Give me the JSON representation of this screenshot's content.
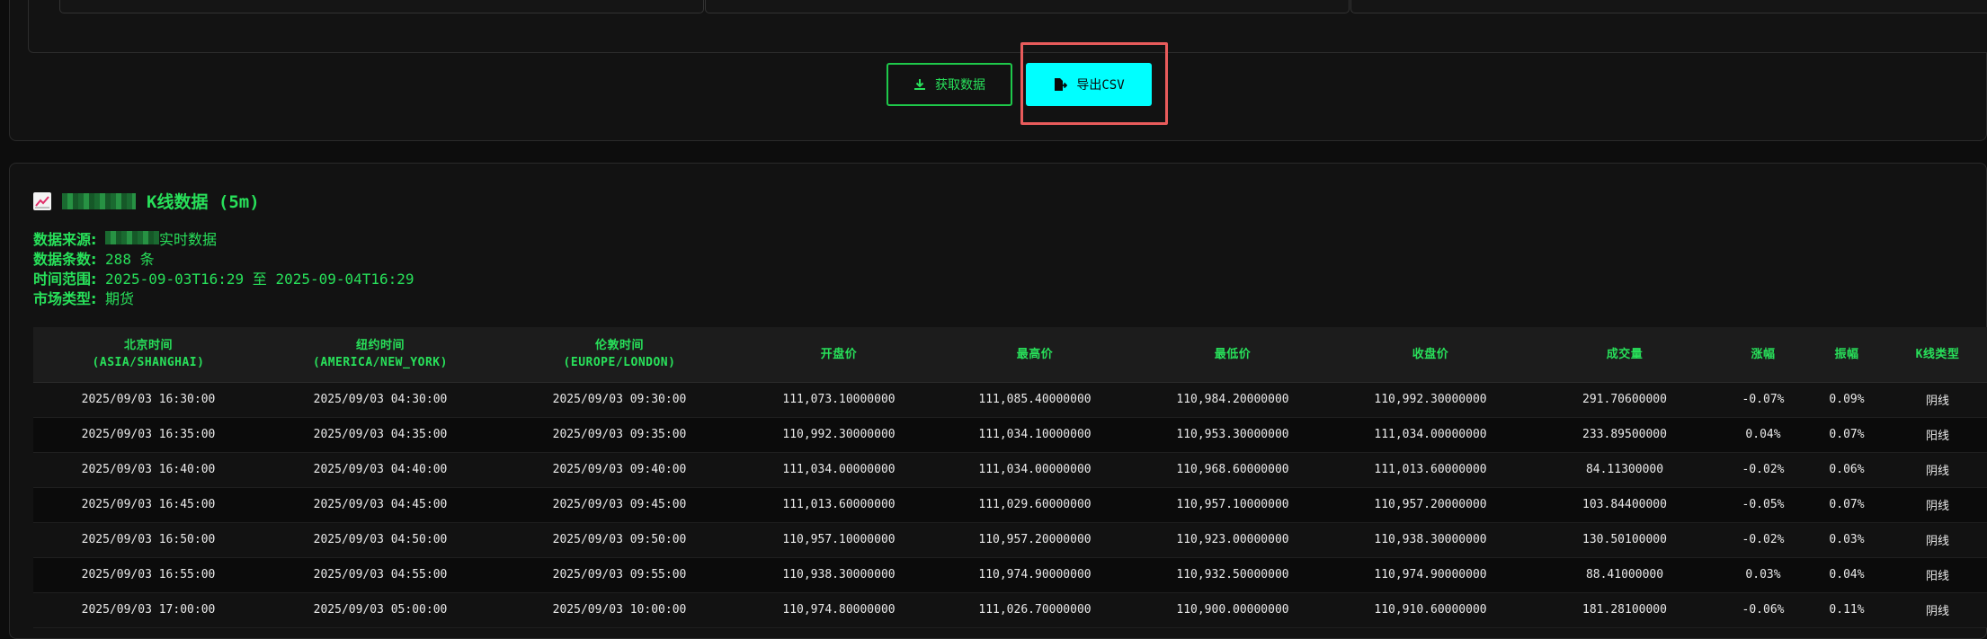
{
  "actions": {
    "fetch_label": "获取数据",
    "export_label": "导出CSV"
  },
  "section": {
    "title_suffix": "K线数据 (5m)"
  },
  "info": {
    "source_label": "数据来源:",
    "source_value": "实时数据",
    "count_label": "数据条数:",
    "count_value": "288 条",
    "range_label": "时间范围:",
    "range_value": "2025-09-03T16:29 至 2025-09-04T16:29",
    "market_label": "市场类型:",
    "market_value": "期货"
  },
  "table": {
    "headers": [
      [
        "北京时间",
        "(ASIA/SHANGHAI)"
      ],
      [
        "纽约时间",
        "(AMERICA/NEW_YORK)"
      ],
      [
        "伦敦时间",
        "(EUROPE/LONDON)"
      ],
      [
        "开盘价",
        ""
      ],
      [
        "最高价",
        ""
      ],
      [
        "最低价",
        ""
      ],
      [
        "收盘价",
        ""
      ],
      [
        "成交量",
        ""
      ],
      [
        "涨幅",
        ""
      ],
      [
        "振幅",
        ""
      ],
      [
        "K线类型",
        ""
      ]
    ],
    "rows": [
      [
        "2025/09/03 16:30:00",
        "2025/09/03 04:30:00",
        "2025/09/03 09:30:00",
        "111,073.10000000",
        "111,085.40000000",
        "110,984.20000000",
        "110,992.30000000",
        "291.70600000",
        "-0.07%",
        "0.09%",
        "阴线"
      ],
      [
        "2025/09/03 16:35:00",
        "2025/09/03 04:35:00",
        "2025/09/03 09:35:00",
        "110,992.30000000",
        "111,034.10000000",
        "110,953.30000000",
        "111,034.00000000",
        "233.89500000",
        "0.04%",
        "0.07%",
        "阳线"
      ],
      [
        "2025/09/03 16:40:00",
        "2025/09/03 04:40:00",
        "2025/09/03 09:40:00",
        "111,034.00000000",
        "111,034.00000000",
        "110,968.60000000",
        "111,013.60000000",
        "84.11300000",
        "-0.02%",
        "0.06%",
        "阴线"
      ],
      [
        "2025/09/03 16:45:00",
        "2025/09/03 04:45:00",
        "2025/09/03 09:45:00",
        "111,013.60000000",
        "111,029.60000000",
        "110,957.10000000",
        "110,957.20000000",
        "103.84400000",
        "-0.05%",
        "0.07%",
        "阴线"
      ],
      [
        "2025/09/03 16:50:00",
        "2025/09/03 04:50:00",
        "2025/09/03 09:50:00",
        "110,957.10000000",
        "110,957.20000000",
        "110,923.00000000",
        "110,938.30000000",
        "130.50100000",
        "-0.02%",
        "0.03%",
        "阴线"
      ],
      [
        "2025/09/03 16:55:00",
        "2025/09/03 04:55:00",
        "2025/09/03 09:55:00",
        "110,938.30000000",
        "110,974.90000000",
        "110,932.50000000",
        "110,974.90000000",
        "88.41000000",
        "0.03%",
        "0.04%",
        "阳线"
      ],
      [
        "2025/09/03 17:00:00",
        "2025/09/03 05:00:00",
        "2025/09/03 10:00:00",
        "110,974.80000000",
        "111,026.70000000",
        "110,900.00000000",
        "110,910.60000000",
        "181.28100000",
        "-0.06%",
        "0.11%",
        "阴线"
      ]
    ]
  }
}
